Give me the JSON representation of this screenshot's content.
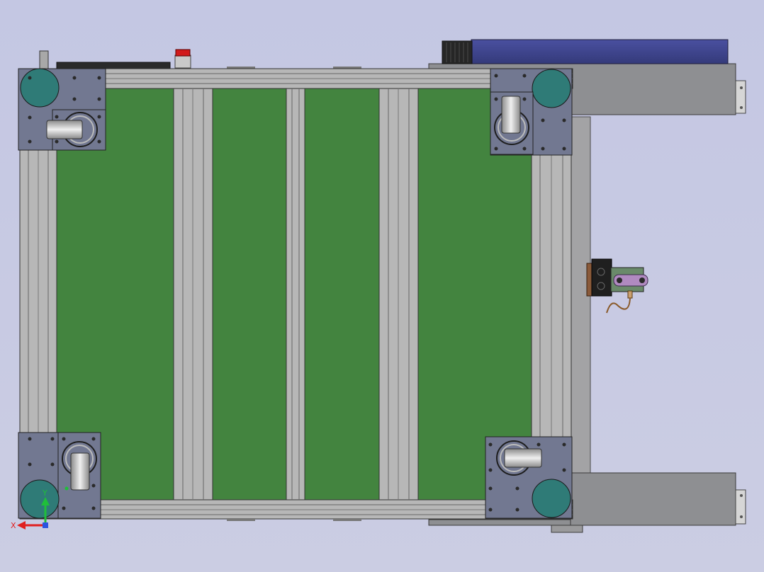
{
  "viewport": {
    "background_top": "#c4c7e3",
    "background_bottom": "#c9cbe3"
  },
  "colors": {
    "panel_green": "#43843f",
    "aluminum": "#b6b6b6",
    "aluminum_dark": "#7d7d7d",
    "plate": "#727891",
    "caster_wheel": "#2f7b77",
    "housing": "#8f9093",
    "motor_cover": "#3a3f86",
    "status_light": "#d11a1a",
    "axis_x": "#e02020",
    "axis_y": "#1fbf3a",
    "axis_z": "#2b55e0"
  },
  "icons": {
    "caster": "caster-wheel-icon",
    "status_light": "status-light-icon",
    "sensor": "sensor-module-icon",
    "triad": "coordinate-triad-icon"
  },
  "triad": {
    "x_label": "X",
    "y_label": "Y"
  }
}
